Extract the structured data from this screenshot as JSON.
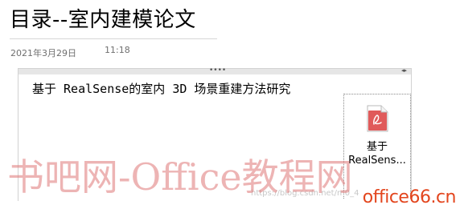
{
  "page": {
    "title": "目录--室内建模论文",
    "date": "2021年3月29日",
    "time": "11:18"
  },
  "note": {
    "text": "基于 RealSense的室内 3D 场景重建方法研究",
    "drag_handle": "••••",
    "resize_arrows": "◂▸"
  },
  "attachment": {
    "icon": "pdf-file-icon",
    "label_line1": "基于",
    "label_line2": "RealSens..."
  },
  "watermark": {
    "big": "书吧网-Office教程网",
    "url": "https://blog.csdn.net/m0_4",
    "logo": "office66.cn"
  },
  "colors": {
    "pdf_red": "#e05a5a",
    "watermark_red": "#de7676",
    "logo_orange": "#e3451d"
  }
}
